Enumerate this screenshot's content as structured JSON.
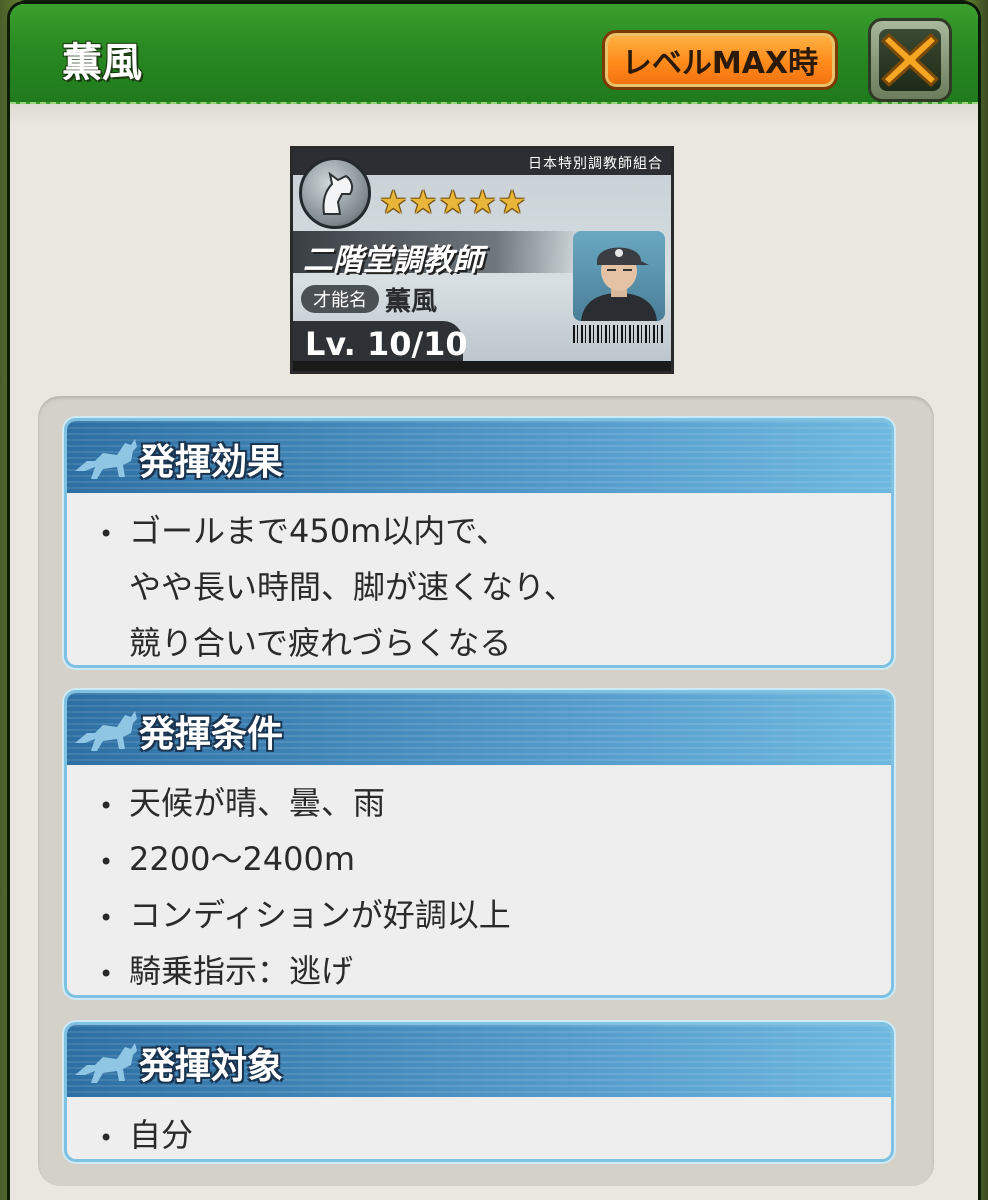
{
  "header": {
    "title": "薫風",
    "max_button_label": "レベルMAX時"
  },
  "card": {
    "organization": "日本特別調教師組合",
    "stars": "★★★★★",
    "trainer_name": "二階堂調教師",
    "talent_tag": "才能名",
    "talent_name": "薫風",
    "level": "Lv. 10/10"
  },
  "sections": {
    "effect": {
      "title": "発揮効果",
      "lines": [
        "ゴールまで450m以内で、",
        "やや長い時間、脚が速くなり、",
        "競り合いで疲れづらくなる"
      ]
    },
    "condition": {
      "title": "発揮条件",
      "lines": [
        "天候が晴、曇、雨",
        "2200〜2400m",
        "コンディションが好調以上",
        "騎乗指示：逃げ"
      ]
    },
    "target": {
      "title": "発揮対象",
      "lines": [
        "自分"
      ]
    }
  },
  "bullet": "•",
  "colors": {
    "header_green": "#2a8a22",
    "max_button_orange": "#ff8a1a",
    "section_head_blue": "#4d93c4",
    "section_border": "#7ec1e0",
    "star_gold": "#e8b63a"
  },
  "icons": [
    "close-icon",
    "horse-icon",
    "horse-emblem-icon",
    "barcode-icon"
  ]
}
